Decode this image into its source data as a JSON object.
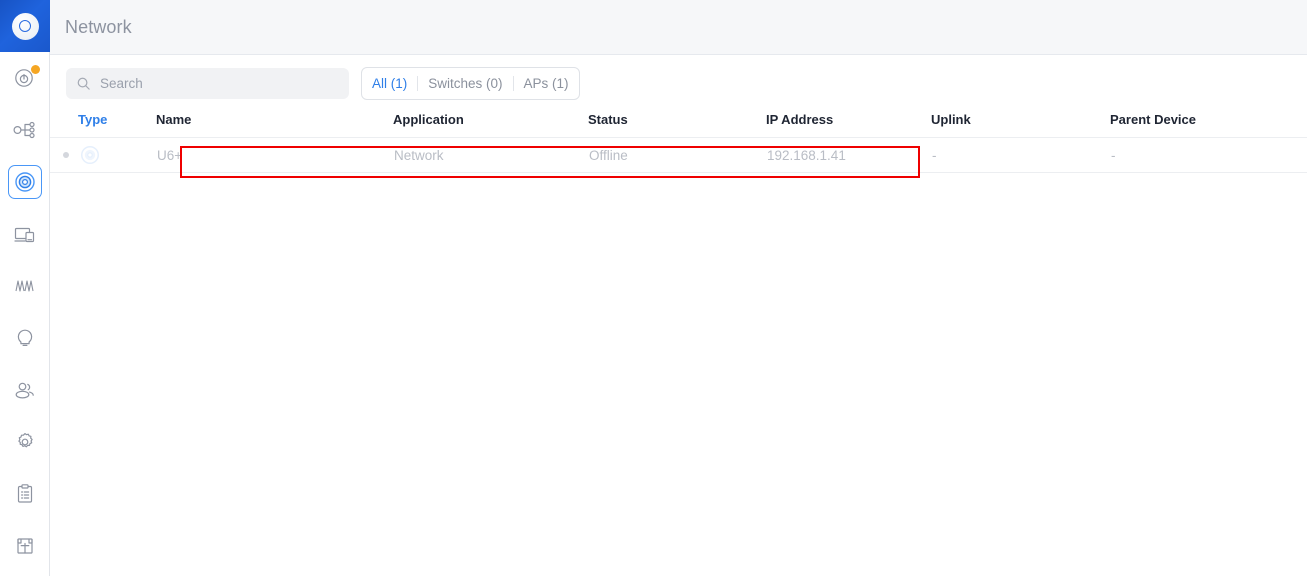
{
  "app": {
    "logo_icon": "unifi-ap-logo-icon",
    "brand_color": "#1f63dd"
  },
  "sidebar": {
    "items": [
      {
        "name": "sidebar-item-dashboard",
        "icon": "ap-dashboard-icon",
        "label": "Dashboard",
        "active": false,
        "badge": true
      },
      {
        "name": "sidebar-item-topology",
        "icon": "topology-icon",
        "label": "Topology",
        "active": false,
        "badge": false
      },
      {
        "name": "sidebar-item-devices",
        "icon": "access-point-icon",
        "label": "Devices",
        "active": true,
        "badge": false
      },
      {
        "name": "sidebar-item-clients",
        "icon": "devices-screen-icon",
        "label": "Clients",
        "active": false,
        "badge": false
      },
      {
        "name": "sidebar-item-statistics",
        "icon": "waveform-icon",
        "label": "Statistics",
        "active": false,
        "badge": false
      },
      {
        "name": "sidebar-item-insights",
        "icon": "lightbulb-icon",
        "label": "Insights",
        "active": false,
        "badge": false
      },
      {
        "name": "sidebar-item-users",
        "icon": "users-icon",
        "label": "Users",
        "active": false,
        "badge": false
      },
      {
        "name": "sidebar-item-settings",
        "icon": "gear-icon",
        "label": "Settings",
        "active": false,
        "badge": false
      },
      {
        "name": "sidebar-item-logs",
        "icon": "clipboard-list-icon",
        "label": "Logs",
        "active": false,
        "badge": false
      },
      {
        "name": "sidebar-item-map",
        "icon": "floorplan-icon",
        "label": "Map",
        "active": false,
        "badge": false
      }
    ]
  },
  "header": {
    "title": "Network"
  },
  "search": {
    "icon": "search-icon",
    "placeholder": "Search",
    "value": ""
  },
  "tabs": [
    {
      "label": "All (1)",
      "active": true
    },
    {
      "label": "Switches (0)",
      "active": false
    },
    {
      "label": "APs (1)",
      "active": false
    }
  ],
  "table": {
    "columns": [
      "Type",
      "Name",
      "Application",
      "Status",
      "IP Address",
      "Uplink",
      "Parent Device"
    ],
    "rows": [
      {
        "status_dot": "offline-dot",
        "type_icon": "access-point-icon",
        "name": "U6+",
        "application": "Network",
        "status": "Offline",
        "ip_address": "192.168.1.41",
        "uplink": "-",
        "parent_device": "-"
      }
    ]
  },
  "annotation": {
    "highlight_color": "#ef0000",
    "target": "device-row-u6-plus"
  }
}
